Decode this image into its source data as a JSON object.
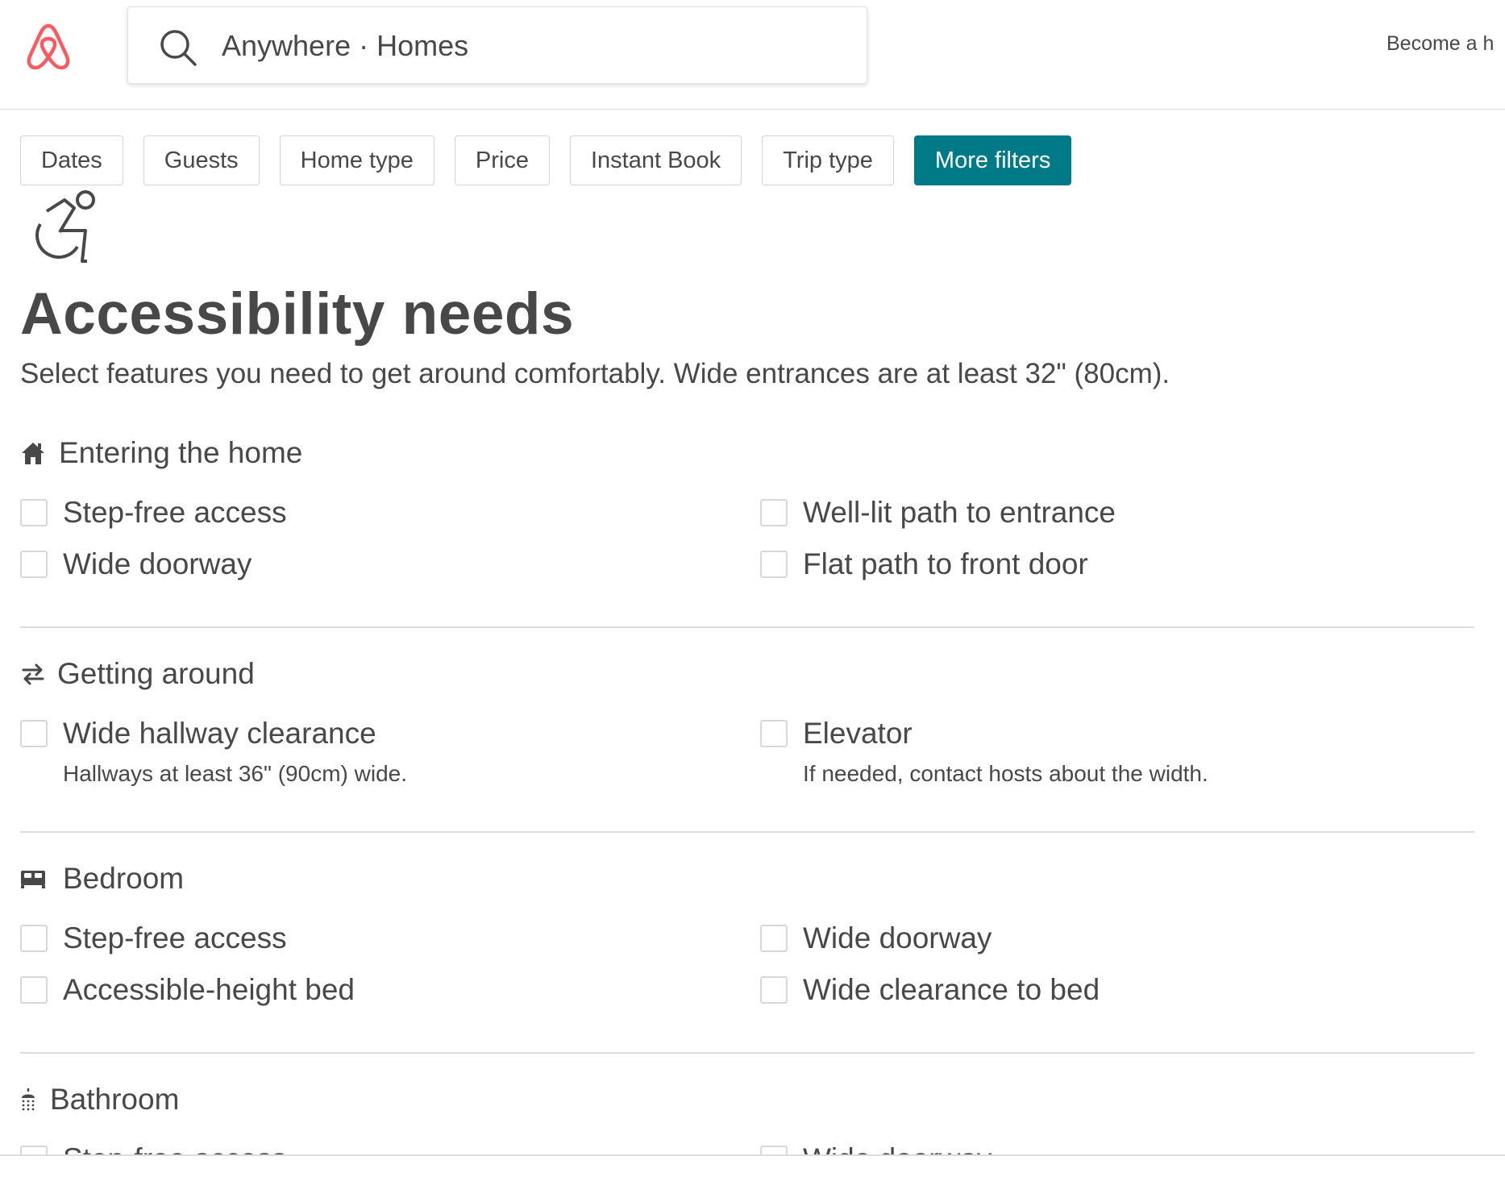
{
  "header": {
    "search_text": "Anywhere · Homes",
    "become_host": "Become a h",
    "brand_color": "#FF5A5F"
  },
  "filters": [
    {
      "label": "Dates"
    },
    {
      "label": "Guests"
    },
    {
      "label": "Home type"
    },
    {
      "label": "Price"
    },
    {
      "label": "Instant Book"
    },
    {
      "label": "Trip type"
    },
    {
      "label": "More filters",
      "active": true,
      "color": "#007A87"
    }
  ],
  "hero": {
    "icon": "wheelchair-icon",
    "title": "Accessibility needs",
    "subtitle": "Select features you need to get around comfortably. Wide entrances are at least 32\" (80cm)."
  },
  "sections": [
    {
      "icon": "home-icon",
      "title": "Entering the home",
      "options": [
        {
          "label": "Step-free access",
          "checked": false
        },
        {
          "label": "Well-lit path to entrance",
          "checked": false
        },
        {
          "label": "Wide doorway",
          "checked": false
        },
        {
          "label": "Flat path to front door",
          "checked": false
        }
      ]
    },
    {
      "icon": "arrows-exchange-icon",
      "title": "Getting around",
      "options": [
        {
          "label": "Wide hallway clearance",
          "description": "Hallways at least 36\" (90cm) wide.",
          "checked": false
        },
        {
          "label": "Elevator",
          "description": "If needed, contact hosts about the width.",
          "checked": false
        }
      ]
    },
    {
      "icon": "bed-icon",
      "title": "Bedroom",
      "options": [
        {
          "label": "Step-free access",
          "checked": false
        },
        {
          "label": "Wide doorway",
          "checked": false
        },
        {
          "label": "Accessible-height bed",
          "checked": false
        },
        {
          "label": "Wide clearance to bed",
          "checked": false
        }
      ]
    },
    {
      "icon": "shower-icon",
      "title": "Bathroom",
      "options": [
        {
          "label": "Step-free access",
          "checked": false
        },
        {
          "label": "Wide doorway",
          "checked": false
        }
      ]
    }
  ]
}
